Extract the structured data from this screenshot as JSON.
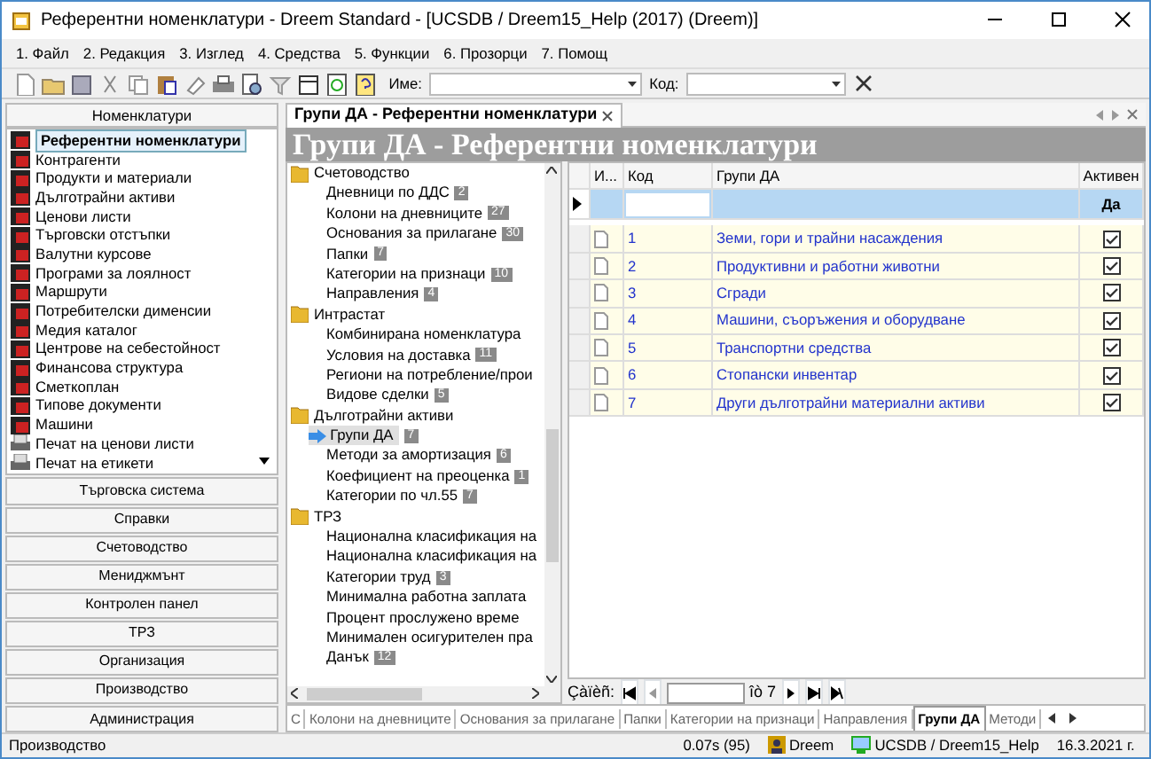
{
  "window": {
    "title": "Референтни номенклатури - Dreem Standard - [UCSDB / Dreem15_Help (2017) (Dreem)]"
  },
  "menu": [
    "1. Файл",
    "2. Редакция",
    "3. Изглед",
    "4. Средства",
    "5. Функции",
    "6. Прозорци",
    "7. Помощ"
  ],
  "toolbar": {
    "name_label": "Име:",
    "code_label": "Код:"
  },
  "sidebar": {
    "header": "Номенклатури",
    "items": [
      {
        "label": "Референтни номенклатури",
        "kind": "module",
        "selected": true
      },
      {
        "label": "Контрагенти",
        "kind": "module",
        "selected": false
      },
      {
        "label": "Продукти и материали",
        "kind": "module",
        "selected": false
      },
      {
        "label": "Дълготрайни активи",
        "kind": "module",
        "selected": false
      },
      {
        "label": "Ценови листи",
        "kind": "module",
        "selected": false
      },
      {
        "label": "Търговски отстъпки",
        "kind": "module",
        "selected": false
      },
      {
        "label": "Валутни курсове",
        "kind": "module",
        "selected": false
      },
      {
        "label": "Програми за лоялност",
        "kind": "module",
        "selected": false
      },
      {
        "label": "Маршрути",
        "kind": "module",
        "selected": false
      },
      {
        "label": "Потребителски дименсии",
        "kind": "module",
        "selected": false
      },
      {
        "label": "Медия каталог",
        "kind": "module",
        "selected": false
      },
      {
        "label": "Центрове на себестойност",
        "kind": "module",
        "selected": false
      },
      {
        "label": "Финансова структура",
        "kind": "module",
        "selected": false
      },
      {
        "label": "Сметкоплан",
        "kind": "module",
        "selected": false
      },
      {
        "label": "Типове документи",
        "kind": "module",
        "selected": false
      },
      {
        "label": "Машини",
        "kind": "module",
        "selected": false
      },
      {
        "label": "Печат на ценови листи",
        "kind": "print",
        "selected": false
      },
      {
        "label": "Печат на етикети",
        "kind": "print",
        "selected": false
      }
    ],
    "sections": [
      "Търговска система",
      "Справки",
      "Счетоводство",
      "Мениджмънт",
      "Контролен панел",
      "ТРЗ",
      "Организация",
      "Производство",
      "Администрация"
    ]
  },
  "document_tab": {
    "label": "Групи ДА - Референтни номенклатури"
  },
  "page_title": "Групи ДА - Референтни номенклатури",
  "tree": [
    {
      "label": "Счетоводство",
      "children": [
        {
          "label": "Дневници по ДДС",
          "count": "2",
          "selected": false
        },
        {
          "label": "Колони на дневниците",
          "count": "27",
          "selected": false
        },
        {
          "label": "Основания за прилагане",
          "count": "30",
          "selected": false
        },
        {
          "label": "Папки",
          "count": "7",
          "selected": false
        },
        {
          "label": "Категории на признаци",
          "count": "10",
          "selected": false
        },
        {
          "label": "Направления",
          "count": "4",
          "selected": false
        }
      ]
    },
    {
      "label": "Интрастат",
      "children": [
        {
          "label": "Комбинирана номенклатура",
          "selected": false
        },
        {
          "label": "Условия на доставка",
          "count": "11",
          "selected": false
        },
        {
          "label": "Региони на потребление/прои",
          "selected": false
        },
        {
          "label": "Видове сделки",
          "count": "5",
          "selected": false
        }
      ]
    },
    {
      "label": "Дълготрайни активи",
      "children": [
        {
          "label": "Групи ДА",
          "count": "7",
          "selected": true
        },
        {
          "label": "Методи за амортизация",
          "count": "6",
          "selected": false
        },
        {
          "label": "Коефициент на преоценка",
          "count": "1",
          "selected": false
        },
        {
          "label": "Категории по чл.55",
          "count": "7",
          "selected": false
        }
      ]
    },
    {
      "label": "ТРЗ",
      "children": [
        {
          "label": "Национална класификация на",
          "selected": false
        },
        {
          "label": "Национална класификация на",
          "selected": false
        },
        {
          "label": "Категории труд",
          "count": "3",
          "selected": false
        },
        {
          "label": "Минимална работна заплата",
          "selected": false
        },
        {
          "label": "Процент прослужено време",
          "selected": false
        },
        {
          "label": "Минимален осигурителен пра",
          "selected": false
        },
        {
          "label": "Данък",
          "count": "12",
          "selected": false
        }
      ]
    }
  ],
  "table": {
    "columns": [
      "И...",
      "Код",
      "Групи ДА",
      "Активен"
    ],
    "filter_active": "Да",
    "rows": [
      {
        "code": "1",
        "name": "Земи, гори и трайни насаждения",
        "active": true
      },
      {
        "code": "2",
        "name": "Продуктивни и работни животни",
        "active": true
      },
      {
        "code": "3",
        "name": "Сгради",
        "active": true
      },
      {
        "code": "4",
        "name": "Машини, съоръжения и оборудване",
        "active": true
      },
      {
        "code": "5",
        "name": "Транспортни средства",
        "active": true
      },
      {
        "code": "6",
        "name": "Стопански инвентар",
        "active": true
      },
      {
        "code": "7",
        "name": "Други дълготрайни материални активи",
        "active": true
      }
    ]
  },
  "navigator": {
    "label": "Çàïèñ:",
    "of": "îò 7"
  },
  "bottom_tabs": [
    {
      "label": "С",
      "selected": false
    },
    {
      "label": "Колони на дневниците",
      "selected": false
    },
    {
      "label": "Основания за прилагане",
      "selected": false
    },
    {
      "label": "Папки",
      "selected": false
    },
    {
      "label": "Категории на признаци",
      "selected": false
    },
    {
      "label": "Направления",
      "selected": false
    },
    {
      "label": "Групи ДА",
      "selected": true
    },
    {
      "label": "Методи",
      "selected": false
    }
  ],
  "status_bar": {
    "module": "Производство",
    "timing": "0.07s (95)",
    "user": "Dreem",
    "database": "UCSDB / Dreem15_Help",
    "date": "16.3.2021 г."
  }
}
